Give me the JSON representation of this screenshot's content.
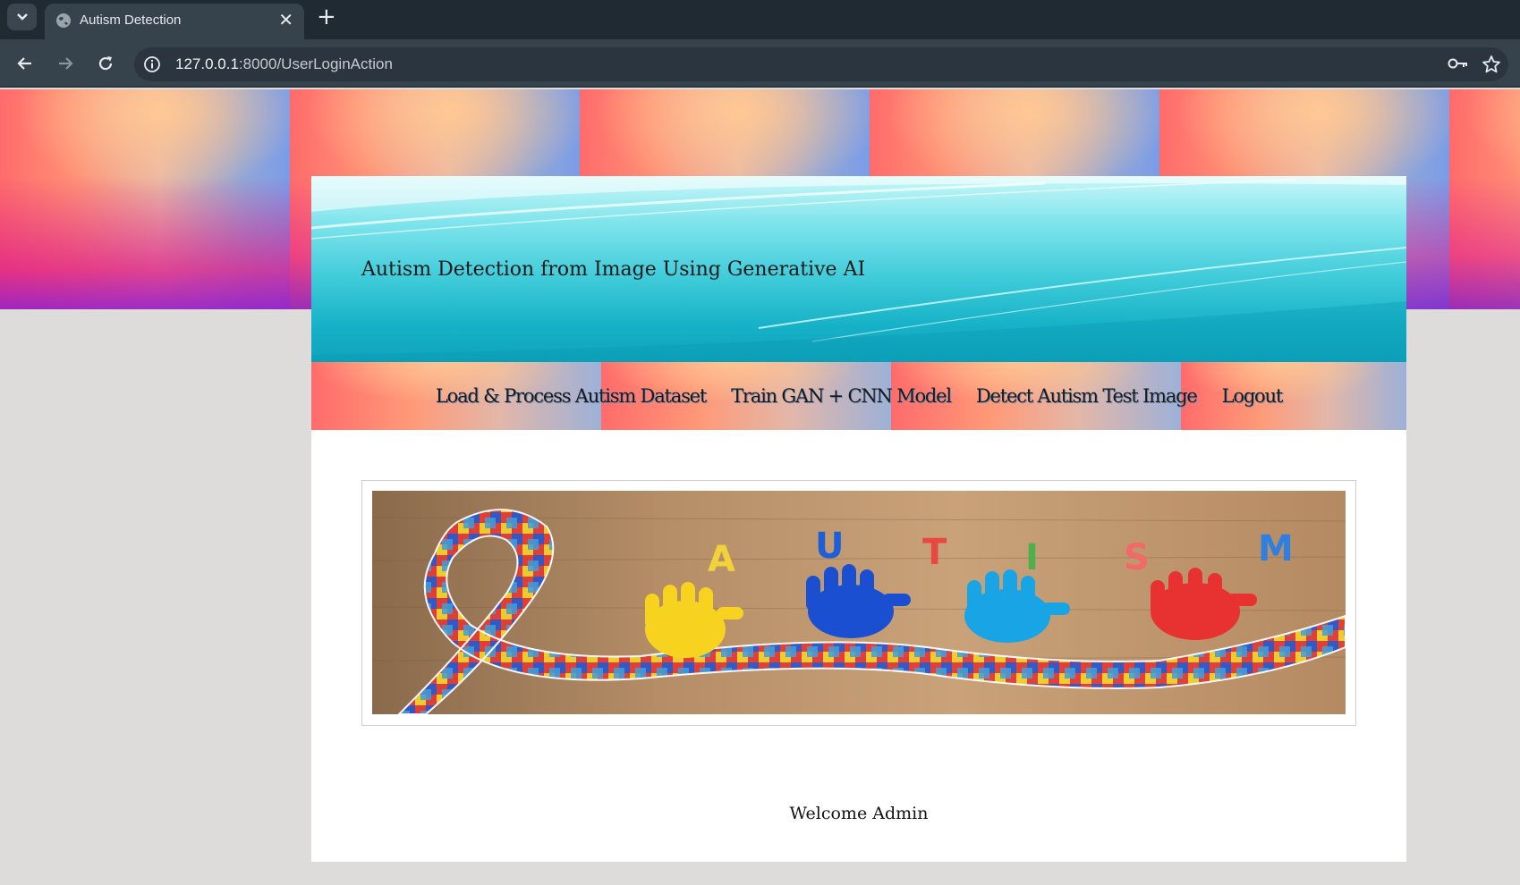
{
  "browser": {
    "tab_title": "Autism Detection",
    "tab_close": "✕",
    "new_tab": "+",
    "url_host": "127.0.0.1",
    "url_rest": ":8000/UserLoginAction"
  },
  "page": {
    "site_title": "Autism Detection from Image Using Generative AI",
    "menu": [
      {
        "label": "Load & Process Autism Dataset"
      },
      {
        "label": "Train GAN + CNN Model"
      },
      {
        "label": "Detect Autism Test Image"
      },
      {
        "label": "Logout"
      }
    ],
    "banner": {
      "letters": [
        "A",
        "U",
        "T",
        "I",
        "S",
        "M"
      ],
      "letter_colors": [
        "#f2d23a",
        "#1f5fd6",
        "#e8483f",
        "#4fb04a",
        "#f06a6a",
        "#2f7fe0"
      ],
      "hand_colors": [
        "#f7d320",
        "#1b4fd1",
        "#19a4e6",
        "#e83232"
      ]
    },
    "welcome": "Welcome Admin"
  },
  "icons": [
    "tab-list-icon",
    "globe-icon",
    "back-arrow-icon",
    "forward-arrow-icon",
    "reload-icon",
    "site-info-icon",
    "password-key-icon",
    "bookmark-star-icon"
  ],
  "colors": {
    "page_bg": "#dedbdb",
    "header_cyan": "#17b2c8",
    "chrome_dark": "#202a33"
  }
}
